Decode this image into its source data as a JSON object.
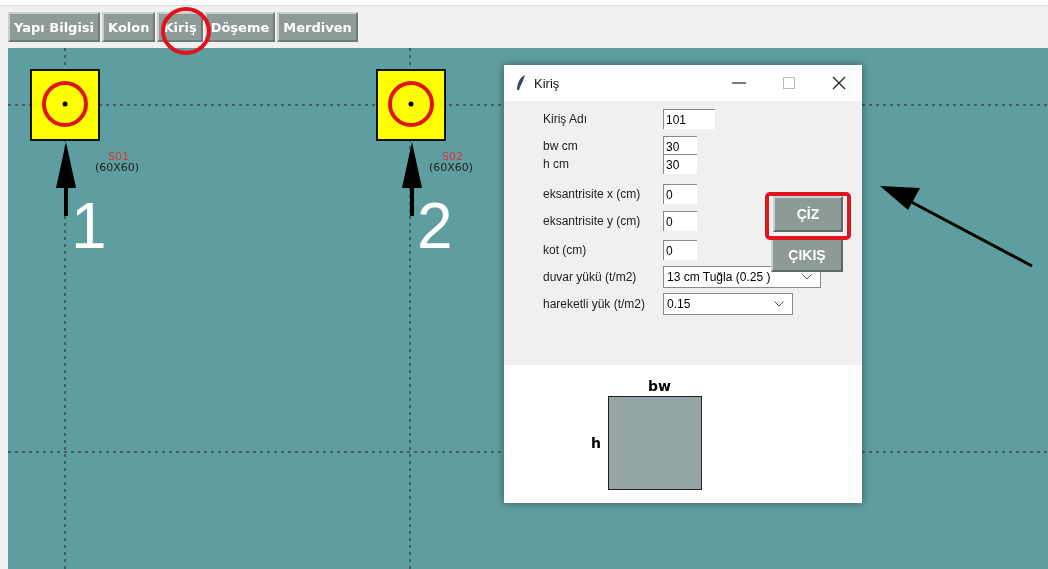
{
  "tabs": [
    {
      "label": "Yapı Bilgisi",
      "selected": false
    },
    {
      "label": "Kolon",
      "selected": false
    },
    {
      "label": "Kiriş",
      "selected": false
    },
    {
      "label": "Döşeme",
      "selected": false
    },
    {
      "label": "Merdiven",
      "selected": false
    }
  ],
  "canvas": {
    "columns": [
      {
        "name": "S01",
        "size": "(60X60)",
        "number": "1"
      },
      {
        "name": "S02",
        "size": "(60X60)",
        "number": "2"
      }
    ]
  },
  "dialog": {
    "title": "Kiriş",
    "fields": [
      {
        "kind": "entry",
        "label": "Kiriş Adı",
        "value": "101"
      },
      {
        "kind": "entry",
        "label": "bw cm",
        "value": "30"
      },
      {
        "kind": "entry",
        "label": "h cm",
        "value": "30"
      },
      {
        "kind": "entry",
        "label": "eksantrisite x  (cm)",
        "value": "0"
      },
      {
        "kind": "entry",
        "label": "eksantrisite y  (cm)",
        "value": "0"
      },
      {
        "kind": "entry",
        "label": "kot  (cm)",
        "value": "0"
      },
      {
        "kind": "combo",
        "label": "duvar yükü (t/m2)",
        "value": "13 cm Tuğla (0.25 )"
      },
      {
        "kind": "combo",
        "label": "hareketli yük (t/m2)",
        "value": "0.15"
      }
    ],
    "buttons": [
      "ÇİZ",
      "ÇIKIŞ"
    ],
    "section": {
      "width_label": "bw",
      "height_label": "h"
    }
  }
}
